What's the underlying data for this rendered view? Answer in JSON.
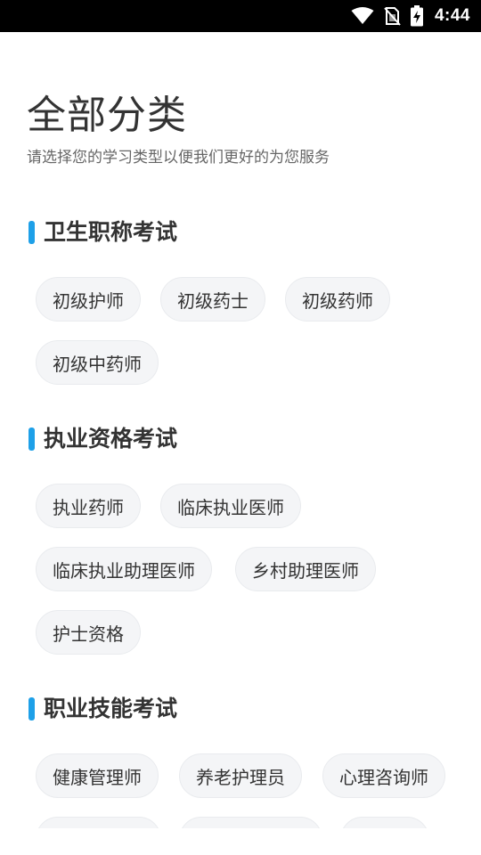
{
  "status_bar": {
    "time": "4:44",
    "icons": [
      "wifi-icon",
      "no-sim-icon",
      "battery-charging-icon"
    ]
  },
  "header": {
    "title": "全部分类",
    "subtitle": "请选择您的学习类型以便我们更好的为您服务"
  },
  "sections": [
    {
      "title": "卫生职称考试",
      "items": [
        "初级护师",
        "初级药士",
        "初级药师",
        "初级中药师"
      ]
    },
    {
      "title": "执业资格考试",
      "items": [
        "执业药师",
        "临床执业医师",
        "临床执业助理医师",
        "乡村助理医师",
        "护士资格"
      ]
    },
    {
      "title": "职业技能考试",
      "items": [
        "健康管理师",
        "养老护理员",
        "心理咨询师"
      ]
    }
  ],
  "colors": {
    "accent": "#1ea0e8",
    "chip_bg": "#f4f5f7",
    "chip_border": "#e9ebee",
    "text_primary": "#333333",
    "text_secondary": "#666666"
  }
}
